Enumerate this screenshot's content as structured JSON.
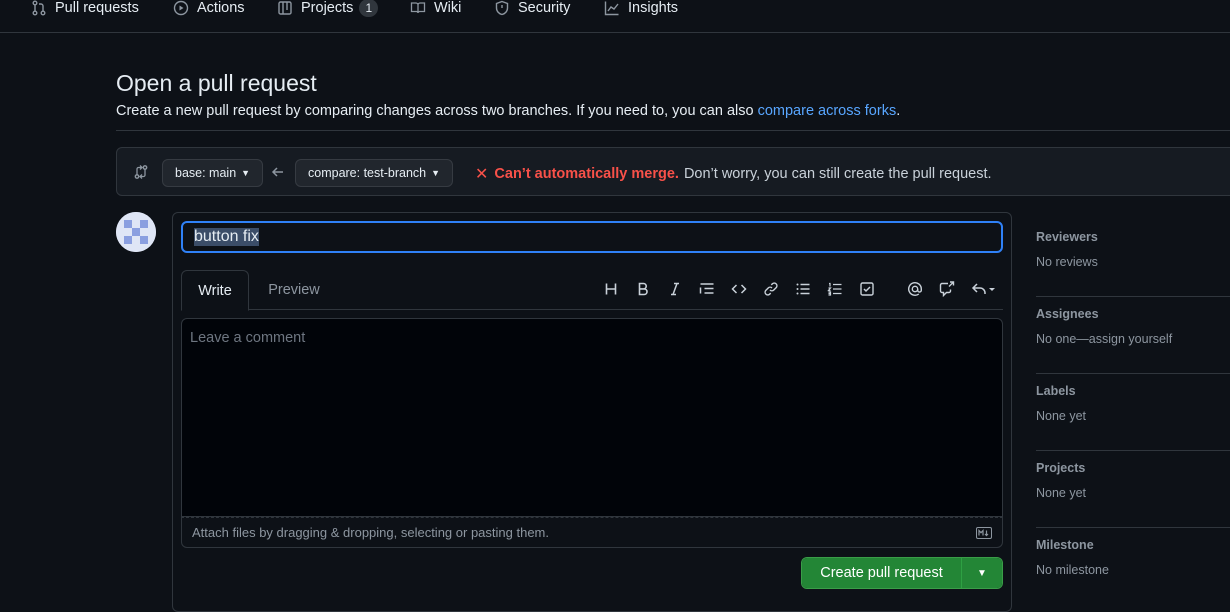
{
  "nav": {
    "items": [
      {
        "label": "Pull requests",
        "icon": "pull-request-icon"
      },
      {
        "label": "Actions",
        "icon": "play-icon"
      },
      {
        "label": "Projects",
        "icon": "table-icon",
        "count": "1"
      },
      {
        "label": "Wiki",
        "icon": "book-icon"
      },
      {
        "label": "Security",
        "icon": "shield-icon"
      },
      {
        "label": "Insights",
        "icon": "graph-icon"
      }
    ]
  },
  "header": {
    "title": "Open a pull request",
    "subtitle": "Create a new pull request by comparing changes across two branches. If you need to, you can also ",
    "subtitle_link": "compare across forks",
    "subtitle_end": "."
  },
  "compare": {
    "base_label": "base: main",
    "compare_label": "compare: test-branch",
    "merge_strong": "Can’t automatically merge.",
    "merge_text": "Don’t worry, you can still create the pull request."
  },
  "composer": {
    "title_value": "button fix",
    "tab_write": "Write",
    "tab_preview": "Preview",
    "body_placeholder": "Leave a comment",
    "attach_text": "Attach files by dragging & dropping, selecting or pasting them.",
    "create_label": "Create pull request"
  },
  "sidebar": {
    "sections": [
      {
        "heading": "Reviewers",
        "value": "No reviews"
      },
      {
        "heading": "Assignees",
        "value": "No one—assign yourself"
      },
      {
        "heading": "Labels",
        "value": "None yet"
      },
      {
        "heading": "Projects",
        "value": "None yet"
      },
      {
        "heading": "Milestone",
        "value": "No milestone"
      }
    ]
  },
  "colors": {
    "background": "#0d1117",
    "accent_blue": "#58a6ff",
    "error_red": "#f85149",
    "primary_green": "#238636"
  }
}
